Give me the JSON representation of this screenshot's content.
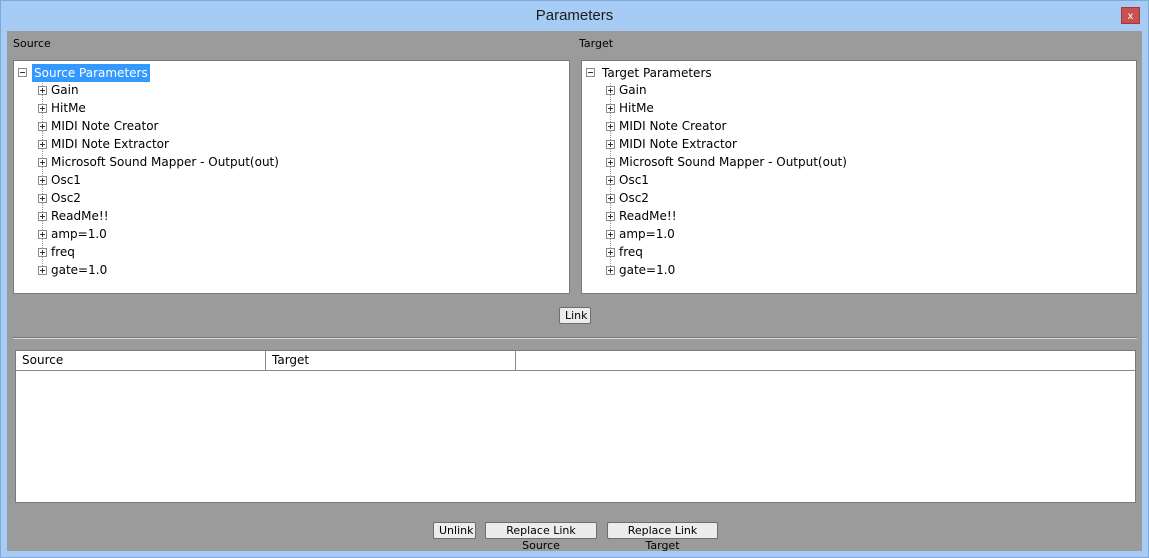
{
  "window": {
    "title": "Parameters",
    "close_label": "x"
  },
  "source": {
    "section_label": "Source",
    "root_label": "Source Parameters",
    "items": [
      "Gain",
      "HitMe",
      "MIDI Note Creator",
      "MIDI Note Extractor",
      "Microsoft Sound Mapper - Output(out)",
      "Osc1",
      "Osc2",
      "ReadMe!!",
      "amp=1.0",
      "freq",
      "gate=1.0"
    ]
  },
  "target": {
    "section_label": "Target",
    "root_label": "Target Parameters",
    "items": [
      "Gain",
      "HitMe",
      "MIDI Note Creator",
      "MIDI Note Extractor",
      "Microsoft Sound Mapper - Output(out)",
      "Osc1",
      "Osc2",
      "ReadMe!!",
      "amp=1.0",
      "freq",
      "gate=1.0"
    ]
  },
  "link_button": "Link",
  "links_table": {
    "columns": [
      "Source",
      "Target",
      ""
    ]
  },
  "buttons": {
    "unlink": "Unlink",
    "replace_source": "Replace Link Source",
    "replace_target": "Replace Link Target"
  },
  "colors": {
    "selection": "#3399ff",
    "client_background": "#9b9b9b",
    "title_bar": "#a6cbf5"
  }
}
